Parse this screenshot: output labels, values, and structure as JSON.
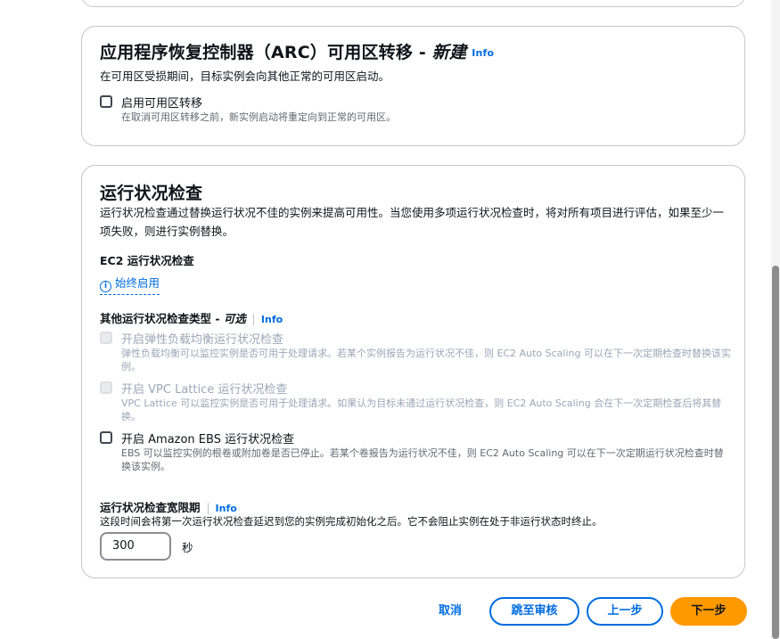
{
  "arc": {
    "title": "应用程序恢复控制器（ARC）可用区转移 - ",
    "title_em": "新建",
    "info": "Info",
    "description": "在可用区受损期间，目标实例会向其他正常的可用区启动。",
    "checkbox_label": "启用可用区转移",
    "checkbox_help": "在取消可用区转移之前，新实例启动将重定向到正常的可用区。"
  },
  "health": {
    "title": "运行状况检查",
    "description": "运行状况检查通过替换运行状况不佳的实例来提高可用性。当您使用多项运行状况检查时，将对所有项目进行评估，如果至少一项失败，则进行实例替换。",
    "ec2_label": "EC2 运行状况检查",
    "ec2_always": "始终启用",
    "other_label": "其他运行状况检查类型 - ",
    "other_label_em": "可选",
    "other_info": "Info",
    "options": [
      {
        "label": "开启弹性负载均衡运行状况检查",
        "help": "弹性负载均衡可以监控实例是否可用于处理请求。若某个实例报告为运行状况不佳，则 EC2 Auto Scaling 可以在下一次定期检查时替换该实例。",
        "checked": false,
        "disabled": true
      },
      {
        "label": "开启 VPC Lattice 运行状况检查",
        "help": "VPC Lattice 可以监控实例是否可用于处理请求。如果认为目标未通过运行状况检查，则 EC2 Auto Scaling 会在下一次定期检查后将其替换。",
        "checked": false,
        "disabled": true
      },
      {
        "label": "开启 Amazon EBS 运行状况检查",
        "help": "EBS 可以监控实例的根卷或附加卷是否已停止。若某个卷报告为运行状况不佳，则 EC2 Auto Scaling 可以在下一次定期运行状况检查时替换该实例。",
        "checked": false,
        "disabled": false
      }
    ],
    "grace_label": "运行状况检查宽限期",
    "grace_info": "Info",
    "grace_description": "这段时间会将第一次运行状况检查延迟到您的实例完成初始化之后。它不会阻止实例在处于非运行状态时终止。",
    "grace_value": "300",
    "grace_unit": "秒"
  },
  "footer": {
    "cancel": "取消",
    "skip_review": "跳至审核",
    "previous": "上一步",
    "next": "下一步"
  },
  "colors": {
    "link": "#006ce0",
    "primary": "#ff9900",
    "border": "#c6c6cd"
  }
}
